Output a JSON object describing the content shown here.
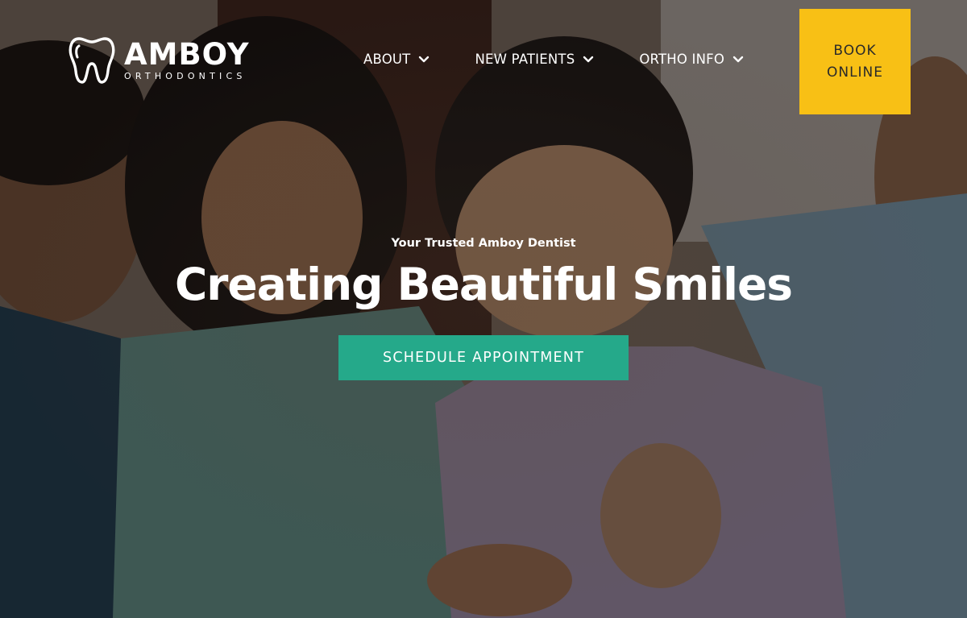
{
  "brand": {
    "name": "AMBOY",
    "subtitle": "ORTHODONTICS"
  },
  "nav": {
    "items": [
      {
        "label": "ABOUT",
        "icon": "chevron-down-icon"
      },
      {
        "label": "NEW PATIENTS",
        "icon": "chevron-down-icon"
      },
      {
        "label": "ORTHO INFO",
        "icon": "chevron-down-icon"
      }
    ],
    "book_line1": "BOOK",
    "book_line2": "ONLINE"
  },
  "hero": {
    "eyebrow": "Your Trusted Amboy Dentist",
    "headline": "Creating Beautiful Smiles",
    "cta_label": "SCHEDULE APPOINTMENT"
  },
  "colors": {
    "book_button": "#f8c015",
    "cta_button": "#25a98a",
    "text": "#ffffff"
  }
}
